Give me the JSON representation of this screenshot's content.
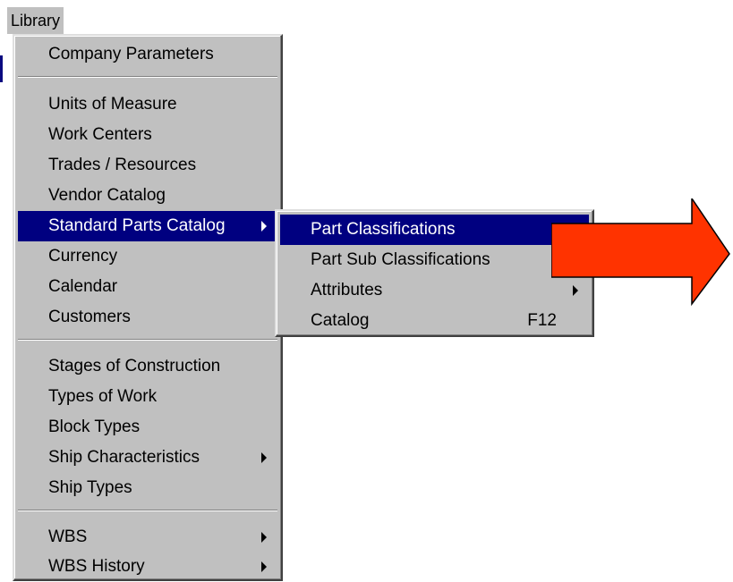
{
  "menubar": {
    "library_label": "Library"
  },
  "library_menu": {
    "items": [
      {
        "label": "Company Parameters"
      },
      {
        "label": "Units of Measure"
      },
      {
        "label": "Work Centers"
      },
      {
        "label": "Trades / Resources"
      },
      {
        "label": "Vendor Catalog"
      },
      {
        "label": "Standard Parts Catalog"
      },
      {
        "label": "Currency"
      },
      {
        "label": "Calendar"
      },
      {
        "label": "Customers"
      },
      {
        "label": "Stages of Construction"
      },
      {
        "label": "Types of Work"
      },
      {
        "label": "Block Types"
      },
      {
        "label": "Ship Characteristics"
      },
      {
        "label": "Ship Types"
      },
      {
        "label": "WBS"
      },
      {
        "label": "WBS History"
      }
    ]
  },
  "standard_parts_submenu": {
    "items": [
      {
        "label": "Part Classifications"
      },
      {
        "label": "Part Sub Classifications"
      },
      {
        "label": "Attributes"
      },
      {
        "label": "Catalog",
        "shortcut": "F12"
      }
    ]
  },
  "colors": {
    "menu_bg": "#c0c0c0",
    "highlight": "#000080",
    "annotation_arrow": "#ff3300"
  }
}
